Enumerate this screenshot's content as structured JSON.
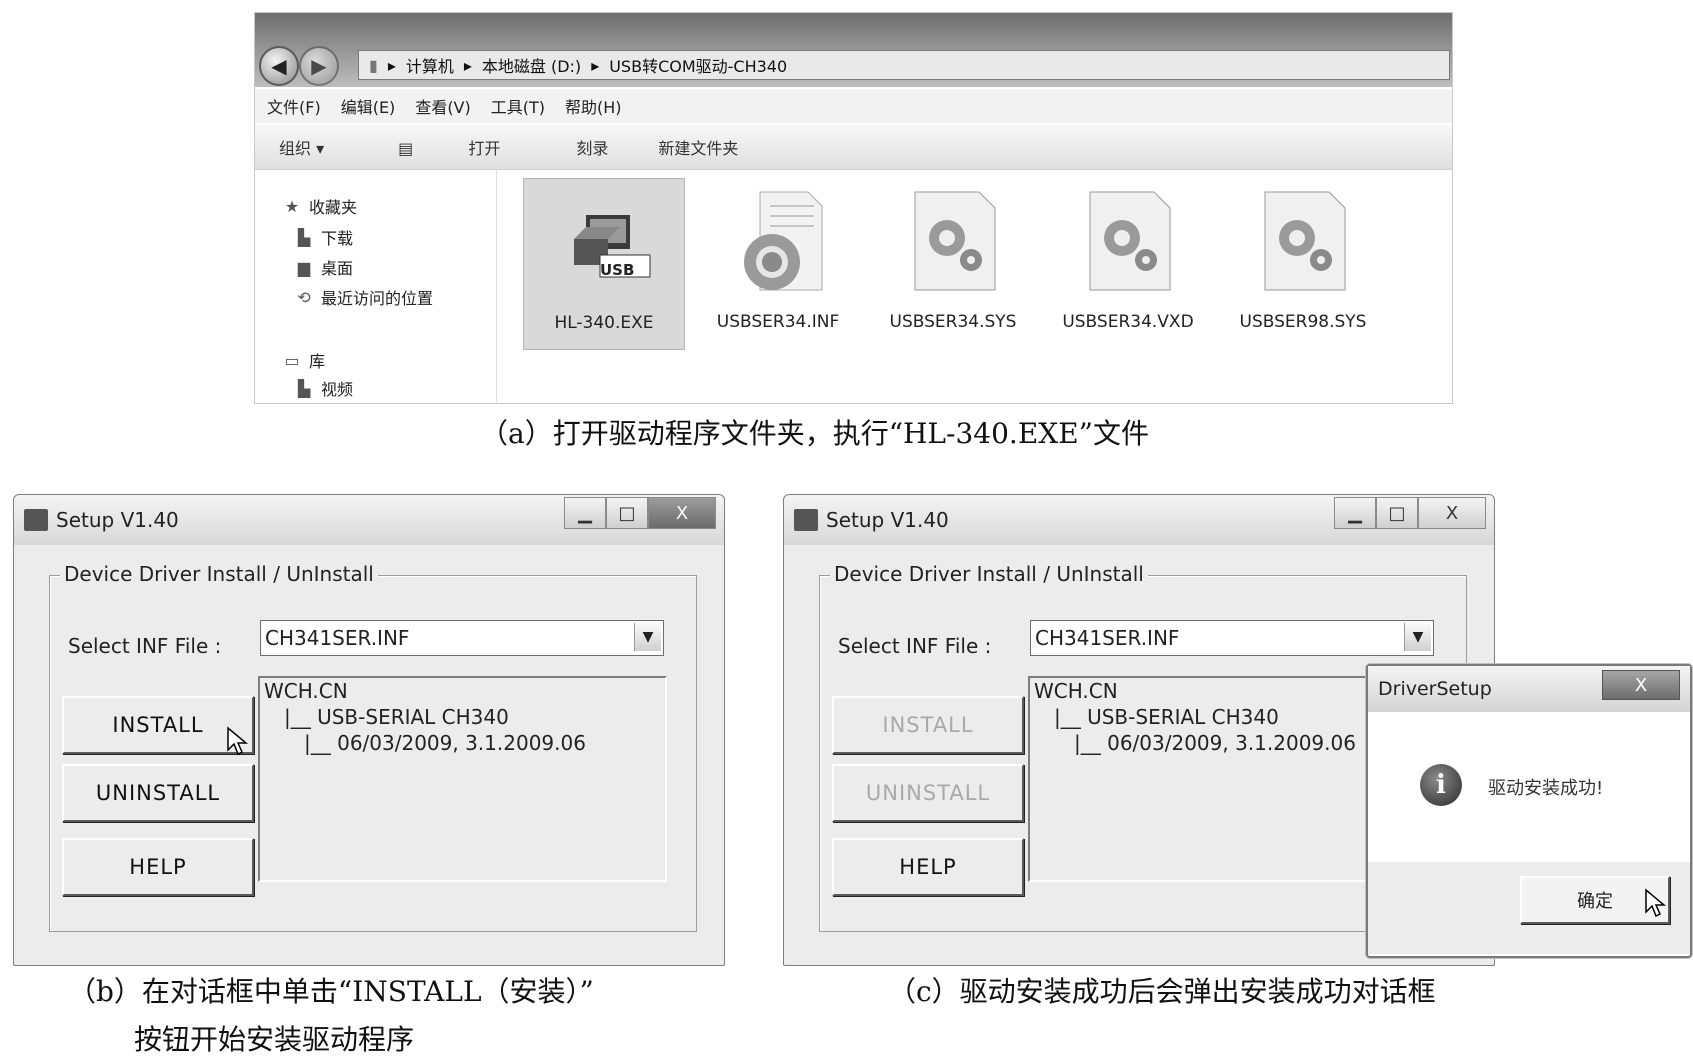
{
  "panel_a": {
    "address": [
      "计算机",
      "本地磁盘 (D:)",
      "USB转COM驱动-CH340"
    ],
    "menu": [
      "文件(F)",
      "编辑(E)",
      "查看(V)",
      "工具(T)",
      "帮助(H)"
    ],
    "toolbar": {
      "organize": "组织 ▾",
      "open": "打开",
      "burn": "刻录",
      "new_folder": "新建文件夹"
    },
    "nav": {
      "favorites": "收藏夹",
      "downloads": "下载",
      "desktop": "桌面",
      "recent": "最近访问的位置",
      "library": "库",
      "videos": "视频"
    },
    "files": [
      "HL-340.EXE",
      "USBSER34.INF",
      "USBSER34.SYS",
      "USBSER34.VXD",
      "USBSER98.SYS"
    ],
    "exe_badge": "USB",
    "caption": "（a）打开驱动程序文件夹，执行“HL-340.EXE”文件"
  },
  "panel_b": {
    "title": "Setup V1.40",
    "group_label": "Device Driver Install / UnInstall",
    "select_label": "Select INF File :",
    "inf_value": "CH341SER.INF",
    "buttons": {
      "install": "INSTALL",
      "uninstall": "UNINSTALL",
      "help": "HELP"
    },
    "tree": [
      "WCH.CN",
      "|__ USB-SERIAL CH340",
      "|__ 06/03/2009, 3.1.2009.06"
    ],
    "caption_line1": "（b）在对话框中单击“INSTALL（安装）”",
    "caption_line2": "按钮开始安装驱动程序"
  },
  "panel_c": {
    "title": "Setup V1.40",
    "group_label": "Device Driver Install / UnInstall",
    "select_label": "Select INF File :",
    "inf_value": "CH341SER.INF",
    "buttons": {
      "install": "INSTALL",
      "uninstall": "UNINSTALL",
      "help": "HELP"
    },
    "tree": [
      "WCH.CN",
      "|__ USB-SERIAL CH340",
      "|__ 06/03/2009, 3.1.2009.06"
    ],
    "msgbox": {
      "title": "DriverSetup",
      "message": "驱动安装成功!",
      "ok": "确定",
      "close": "X"
    },
    "caption": "（c）驱动安装成功后会弹出安装成功对话框"
  },
  "caption_buttons": {
    "minimize": "▁",
    "maximize": "□",
    "close": "X"
  }
}
